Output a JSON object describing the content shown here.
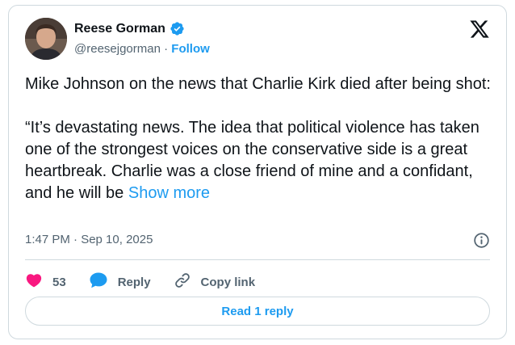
{
  "author": {
    "display_name": "Reese Gorman",
    "handle": "@reesejgorman",
    "separator": "·",
    "follow_label": "Follow",
    "verified": true
  },
  "tweet": {
    "text": "Mike Johnson on the news that Charlie Kirk died after being shot:\n\n“It’s devastating news. The idea that political violence has taken one of the strongest voices on the conservative side is a great heartbreak. Charlie was a close friend of mine and a confidant, and he will be ",
    "show_more_label": "Show more",
    "timestamp": "1:47 PM · Sep 10, 2025"
  },
  "actions": {
    "like_count": "53",
    "reply_label": "Reply",
    "copy_link_label": "Copy link"
  },
  "read_replies_label": "Read 1 reply",
  "icons": {
    "verified": "verified-badge-icon",
    "platform": "x-logo-icon",
    "info": "info-icon",
    "like": "heart-icon",
    "reply": "speech-bubble-icon",
    "copy": "link-icon"
  },
  "colors": {
    "accent": "#1d9bf0",
    "like": "#f91880",
    "text": "#0f1419",
    "secondary": "#536471",
    "border": "#cfd9de"
  }
}
